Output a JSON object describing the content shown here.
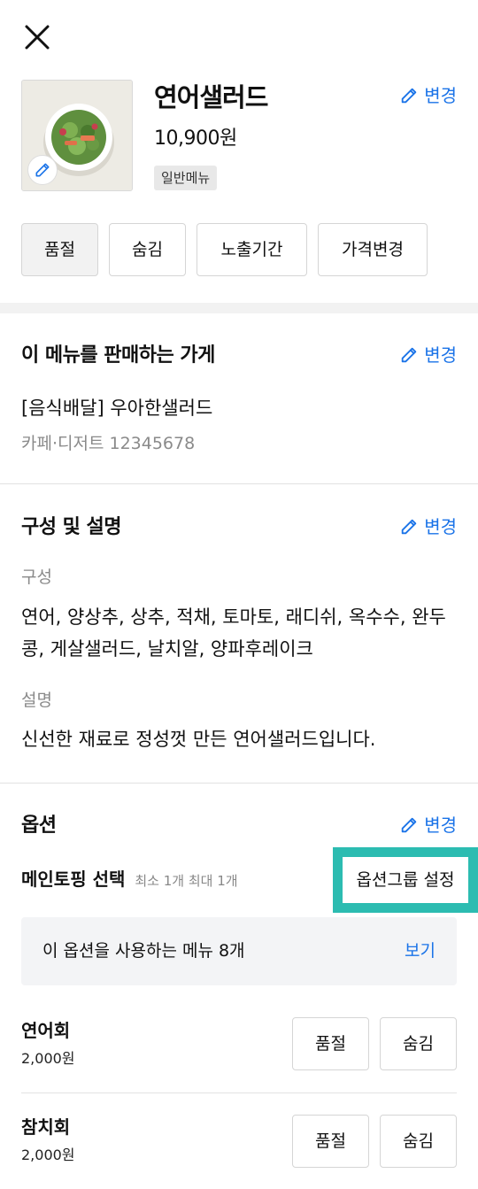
{
  "header": {
    "close_icon": "close-icon"
  },
  "menu": {
    "name": "연어샐러드",
    "price": "10,900원",
    "badge": "일반메뉴",
    "edit_label": "변경",
    "actions": [
      "품절",
      "숨김",
      "노출기간",
      "가격변경"
    ]
  },
  "store_section": {
    "title": "이 메뉴를 판매하는 가게",
    "edit_label": "변경",
    "store_name": "[음식배달] 우아한샐러드",
    "store_meta": "카페·디저트 12345678"
  },
  "composition_section": {
    "title": "구성 및 설명",
    "edit_label": "변경",
    "composition_label": "구성",
    "composition_text": "연어, 양상추, 상추, 적채, 토마토, 래디쉬, 옥수수, 완두콩, 게살샐러드, 날치알, 양파후레이크",
    "description_label": "설명",
    "description_text": "신선한 재료로 정성껏 만든 연어샐러드입니다."
  },
  "options_section": {
    "title": "옵션",
    "edit_label": "변경",
    "group_name": "메인토핑 선택",
    "group_limits": "최소 1개 최대 1개",
    "group_settings_label": "옵션그룹 설정",
    "usage_text": "이 옵션을 사용하는 메뉴 8개",
    "usage_link": "보기",
    "items": [
      {
        "name": "연어회",
        "price": "2,000원",
        "soldout_label": "품절",
        "hide_label": "숨김"
      },
      {
        "name": "참치회",
        "price": "2,000원",
        "soldout_label": "품절",
        "hide_label": "숨김"
      }
    ]
  },
  "colors": {
    "accent_blue": "#1a73e8",
    "highlight_teal": "#2cbcb1",
    "divider_gray": "#f2f2f2"
  }
}
